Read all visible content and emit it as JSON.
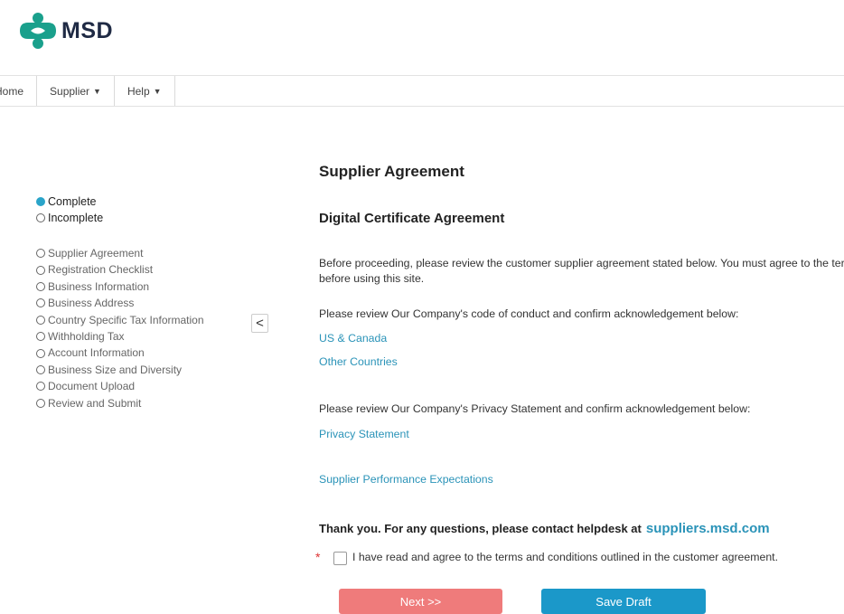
{
  "brand": {
    "name": "MSD",
    "logo_color": "#1aa08c"
  },
  "nav": {
    "home": "Home",
    "supplier": "Supplier",
    "help": "Help"
  },
  "legend": {
    "complete": "Complete",
    "incomplete": "Incomplete"
  },
  "steps": [
    "Supplier Agreement",
    "Registration Checklist",
    "Business Information",
    "Business Address",
    "Country Specific Tax Information",
    "Withholding Tax",
    "Account Information",
    "Business Size and Diversity",
    "Document Upload",
    "Review and Submit"
  ],
  "collapse_label": "<",
  "main": {
    "title": "Supplier Agreement",
    "subtitle": "Digital Certificate Agreement",
    "intro": "Before proceeding, please review the customer supplier agreement stated below. You must agree to the terms before using this site.",
    "code_prompt": "Please review Our Company's code of conduct and confirm acknowledgement below:",
    "link_us": "US & Canada",
    "link_other": "Other Countries",
    "privacy_prompt": "Please review Our Company's Privacy Statement and confirm acknowledgement below:",
    "link_privacy": "Privacy Statement",
    "link_performance": "Supplier Performance Expectations",
    "thanks": "Thank you. For any questions, please contact helpdesk at",
    "helpdesk": "suppliers.msd.com",
    "required_mark": "*",
    "agree_text": "I have read and agree to the terms and conditions outlined in the customer agreement."
  },
  "buttons": {
    "next": "Next >>",
    "save": "Save Draft"
  },
  "colors": {
    "accent": "#2a93b8",
    "next": "#ef7b7b",
    "save": "#1b98c9"
  }
}
